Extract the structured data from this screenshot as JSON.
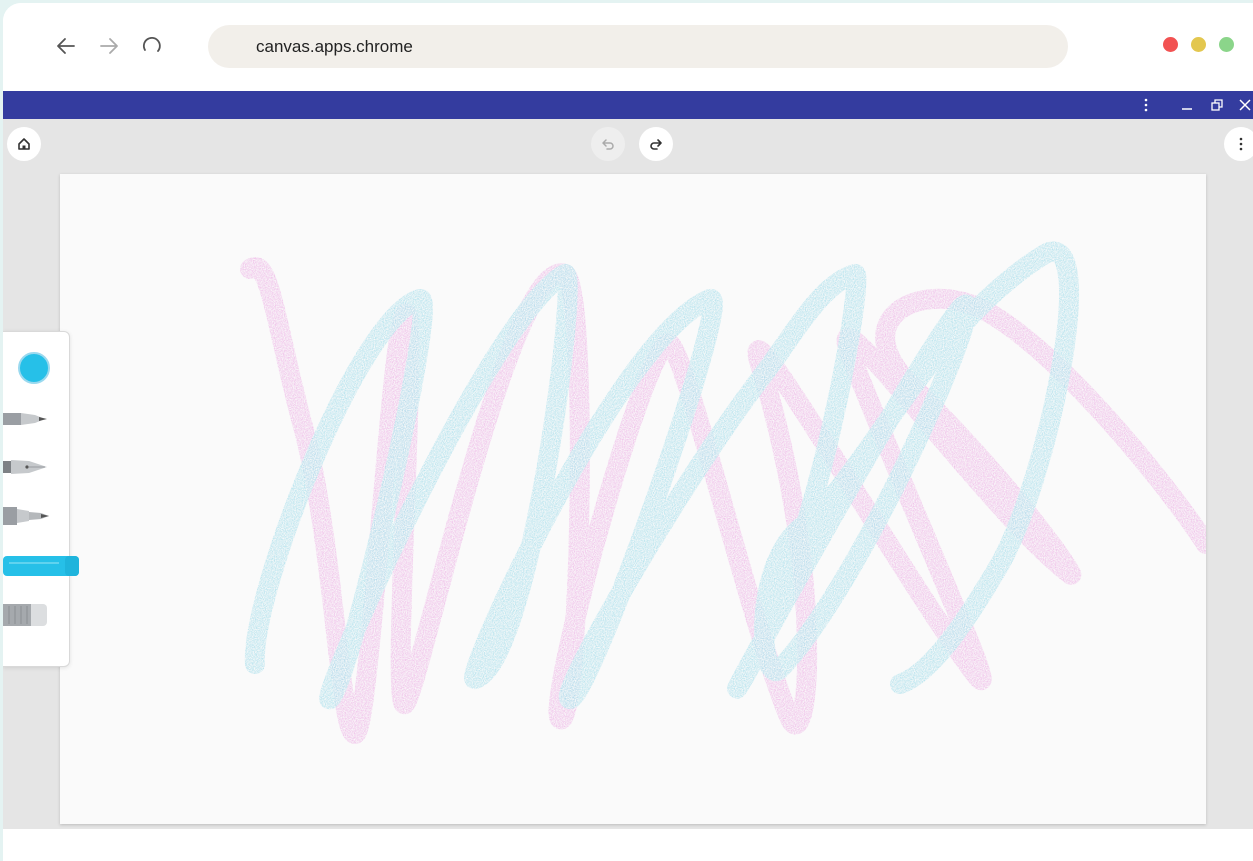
{
  "browser": {
    "url": "canvas.apps.chrome",
    "icons": {
      "back": "arrow-left-icon",
      "forward": "arrow-right-icon",
      "reload": "reload-icon"
    },
    "window_controls": {
      "close_color": "#f25252",
      "minimize_color": "#e3c74f",
      "maximize_color": "#8bd58a"
    }
  },
  "app_titlebar": {
    "color": "#343c9f",
    "icons": [
      "more-vertical-icon",
      "minimize-icon",
      "restore-icon",
      "close-icon"
    ]
  },
  "toolbar": {
    "icons": {
      "home": "home-icon",
      "undo": "undo-icon",
      "redo": "redo-icon",
      "menu": "more-vertical-icon"
    },
    "undo_enabled": false,
    "redo_enabled": true
  },
  "tools": {
    "selected_color": "#26c0e8",
    "items": [
      "pencil",
      "pen",
      "marker",
      "highlighter",
      "eraser"
    ],
    "active": "highlighter"
  },
  "canvas": {
    "background": "#fafafa",
    "strokes": [
      {
        "tool": "highlighter",
        "color": "#8fd6e6"
      },
      {
        "tool": "highlighter",
        "color": "#eaa2e1"
      }
    ]
  }
}
